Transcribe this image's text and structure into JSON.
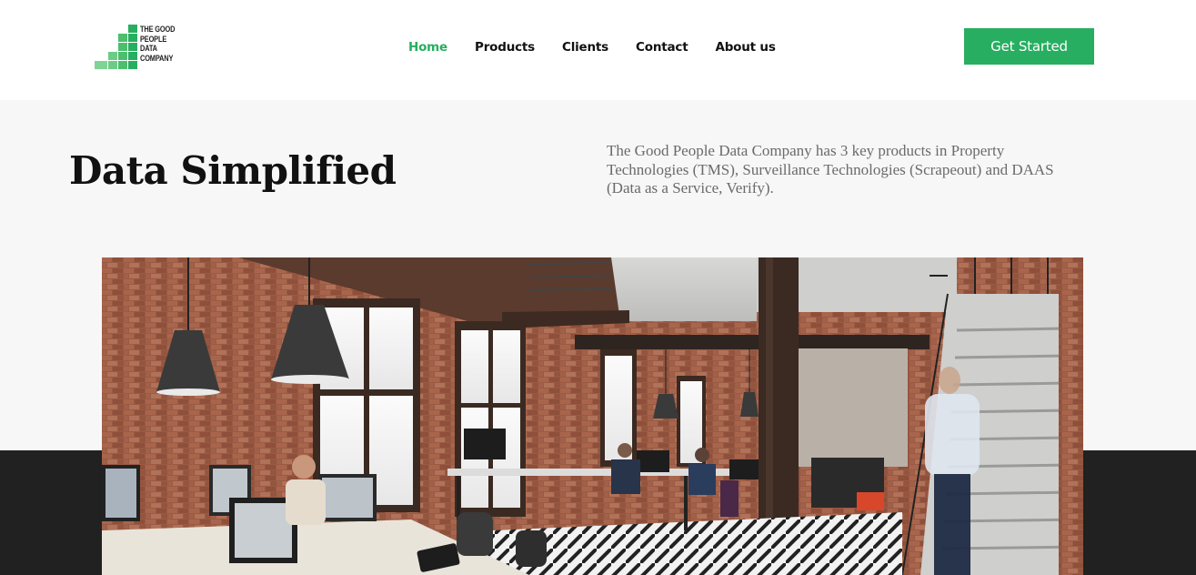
{
  "brand": {
    "logo_lines": [
      "THE GOOD",
      "PEOPLE",
      "DATA",
      "COMPANY"
    ],
    "logo_color": "#27ae60"
  },
  "nav": {
    "items": [
      {
        "label": "Home",
        "active": true
      },
      {
        "label": "Products",
        "active": false
      },
      {
        "label": "Clients",
        "active": false
      },
      {
        "label": "Contact",
        "active": false
      },
      {
        "label": "About us",
        "active": false
      }
    ],
    "accent_color": "#27ae60"
  },
  "cta": {
    "label": "Get Started"
  },
  "hero": {
    "title": "Data Simplified",
    "description": "The Good People Data Company has 3 key products in Property Technologies (TMS), Surveillance Technologies (Scrapeout) and DAAS (Data as a Service, Verify)."
  },
  "image": {
    "subject": "open-plan office with brick walls, pendant lamps and a staircase"
  }
}
